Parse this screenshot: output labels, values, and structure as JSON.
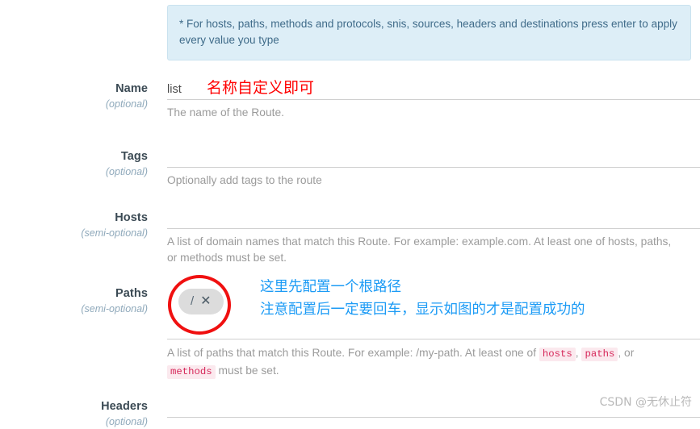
{
  "banner": {
    "text": "* For hosts, paths, methods and protocols, snis, sources, headers and destinations press enter to apply every value you type"
  },
  "form": {
    "rows": [
      {
        "label": "Name",
        "sublabel": "(optional)",
        "value": "list",
        "help_prefix": "The name of the Route.",
        "help_codes": [],
        "help_suffix": ""
      },
      {
        "label": "Tags",
        "sublabel": "(optional)",
        "value": "",
        "help_prefix": "Optionally add tags to the route",
        "help_codes": [],
        "help_suffix": ""
      },
      {
        "label": "Hosts",
        "sublabel": "(semi-optional)",
        "value": "",
        "help_prefix": "A list of domain names that match this Route. For example: example.com. At least one of hosts, paths, or methods must be set.",
        "help_codes": [],
        "help_suffix": ""
      },
      {
        "label": "Paths",
        "sublabel": "(semi-optional)",
        "value": "",
        "help_prefix": "A list of paths that match this Route. For example: /my-path. At least one of ",
        "help_codes": [
          "hosts",
          "paths",
          "methods"
        ],
        "help_suffix": " must be set."
      },
      {
        "label": "Headers",
        "sublabel": "(optional)",
        "value": "",
        "help_prefix": "",
        "help_codes": [],
        "help_suffix": ""
      }
    ],
    "paths_tag": {
      "text": "/",
      "remove": "✕"
    },
    "help_separator_1": ", ",
    "help_separator_2": ", or "
  },
  "annotations": {
    "name_note": "名称自定义即可",
    "paths_note_line1": "这里先配置一个根路径",
    "paths_note_line2": "注意配置后一定要回车，显示如图的才是配置成功的"
  },
  "watermark": {
    "text": "CSDN @无休止符"
  },
  "colors": {
    "banner_bg": "#ddeef7",
    "banner_text": "#3f6b89",
    "label": "#3b4a54",
    "sublabel": "#8fa9bb",
    "help": "#9b9b9b",
    "code_bg": "#fbe9ee",
    "code_text": "#d6285a",
    "tag_bg": "#dcdcdc",
    "annotation_red": "#ff0000",
    "annotation_blue": "#1c9bf5",
    "circle_red": "#f01010"
  }
}
